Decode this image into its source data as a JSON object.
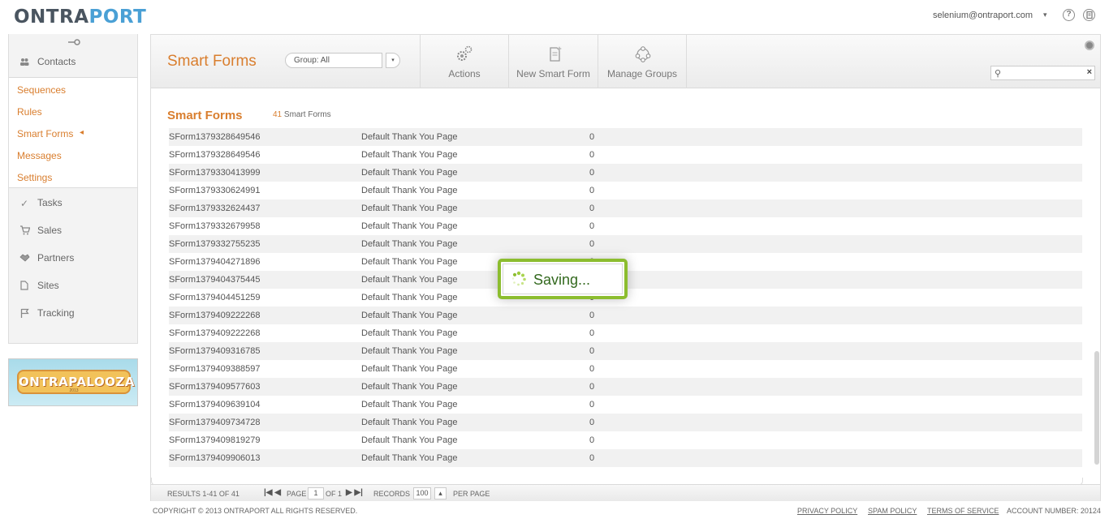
{
  "header": {
    "logo_part1": "ONTRA",
    "logo_part2": "PORT",
    "user_email": "selenium@ontraport.com",
    "user_caret": "▾",
    "help_icon_glyph": "?",
    "colors": {
      "brand_orange": "#d97e2e",
      "logo_dark": "#4a5560",
      "logo_blue": "#4aa0d5",
      "saving_green": "#8cbd2f"
    }
  },
  "sidebar": {
    "contacts_label": "Contacts",
    "sub_items": [
      {
        "label": "Sequences"
      },
      {
        "label": "Rules"
      },
      {
        "label": "Smart Forms",
        "active": true
      },
      {
        "label": "Messages"
      },
      {
        "label": "Settings"
      }
    ],
    "active_marker": "◂",
    "nav_items": [
      {
        "label": "Tasks",
        "icon": "check-icon"
      },
      {
        "label": "Sales",
        "icon": "cart-icon"
      },
      {
        "label": "Partners",
        "icon": "handshake-icon"
      },
      {
        "label": "Sites",
        "icon": "page-icon"
      },
      {
        "label": "Tracking",
        "icon": "flag-icon"
      }
    ],
    "promo": {
      "title": "ONTRAPALOOZA",
      "year": "2013"
    }
  },
  "toolbar": {
    "title": "Smart Forms",
    "group_select": "Group: All",
    "group_drop": "▾",
    "actions_label": "Actions",
    "new_form_label": "New Smart Form",
    "manage_groups_label": "Manage Groups",
    "search_placeholder": "",
    "search_icon": "⚲",
    "search_clear": "×"
  },
  "list": {
    "title": "Smart Forms",
    "count_number": "41",
    "count_label": "Smart Forms",
    "rows": [
      {
        "name": "SForm1379328649546",
        "thank_you": "Default Thank You Page",
        "count": "0"
      },
      {
        "name": "SForm1379328649546",
        "thank_you": "Default Thank You Page",
        "count": "0"
      },
      {
        "name": "SForm1379330413999",
        "thank_you": "Default Thank You Page",
        "count": "0"
      },
      {
        "name": "SForm1379330624991",
        "thank_you": "Default Thank You Page",
        "count": "0"
      },
      {
        "name": "SForm1379332624437",
        "thank_you": "Default Thank You Page",
        "count": "0"
      },
      {
        "name": "SForm1379332679958",
        "thank_you": "Default Thank You Page",
        "count": "0"
      },
      {
        "name": "SForm1379332755235",
        "thank_you": "Default Thank You Page",
        "count": "0"
      },
      {
        "name": "SForm1379404271896",
        "thank_you": "Default Thank You Page",
        "count": "0"
      },
      {
        "name": "SForm1379404375445",
        "thank_you": "Default Thank You Page",
        "count": "0"
      },
      {
        "name": "SForm1379404451259",
        "thank_you": "Default Thank You Page",
        "count": "0"
      },
      {
        "name": "SForm1379409222268",
        "thank_you": "Default Thank You Page",
        "count": "0"
      },
      {
        "name": "SForm1379409222268",
        "thank_you": "Default Thank You Page",
        "count": "0"
      },
      {
        "name": "SForm1379409316785",
        "thank_you": "Default Thank You Page",
        "count": "0"
      },
      {
        "name": "SForm1379409388597",
        "thank_you": "Default Thank You Page",
        "count": "0"
      },
      {
        "name": "SForm1379409577603",
        "thank_you": "Default Thank You Page",
        "count": "0"
      },
      {
        "name": "SForm1379409639104",
        "thank_you": "Default Thank You Page",
        "count": "0"
      },
      {
        "name": "SForm1379409734728",
        "thank_you": "Default Thank You Page",
        "count": "0"
      },
      {
        "name": "SForm1379409819279",
        "thank_you": "Default Thank You Page",
        "count": "0"
      },
      {
        "name": "SForm1379409906013",
        "thank_you": "Default Thank You Page",
        "count": "0"
      }
    ]
  },
  "pager": {
    "results": "RESULTS 1-41 OF 41",
    "first_prev": "|◀ ◀",
    "page_label": "PAGE",
    "page_value": "1",
    "of_label": "OF 1",
    "next_last": "▶ ▶|",
    "records_label": "RECORDS",
    "records_value": "100",
    "records_caret": "▴",
    "per_page_label": "PER PAGE"
  },
  "footer": {
    "copyright": "COPYRIGHT © 2013 ONTRAPORT ALL RIGHTS RESERVED.",
    "privacy": "PRIVACY POLICY",
    "spam": "SPAM POLICY",
    "terms": "TERMS OF SERVICE",
    "account": "ACCOUNT NUMBER: 20124"
  },
  "overlay": {
    "saving_text": "Saving..."
  }
}
